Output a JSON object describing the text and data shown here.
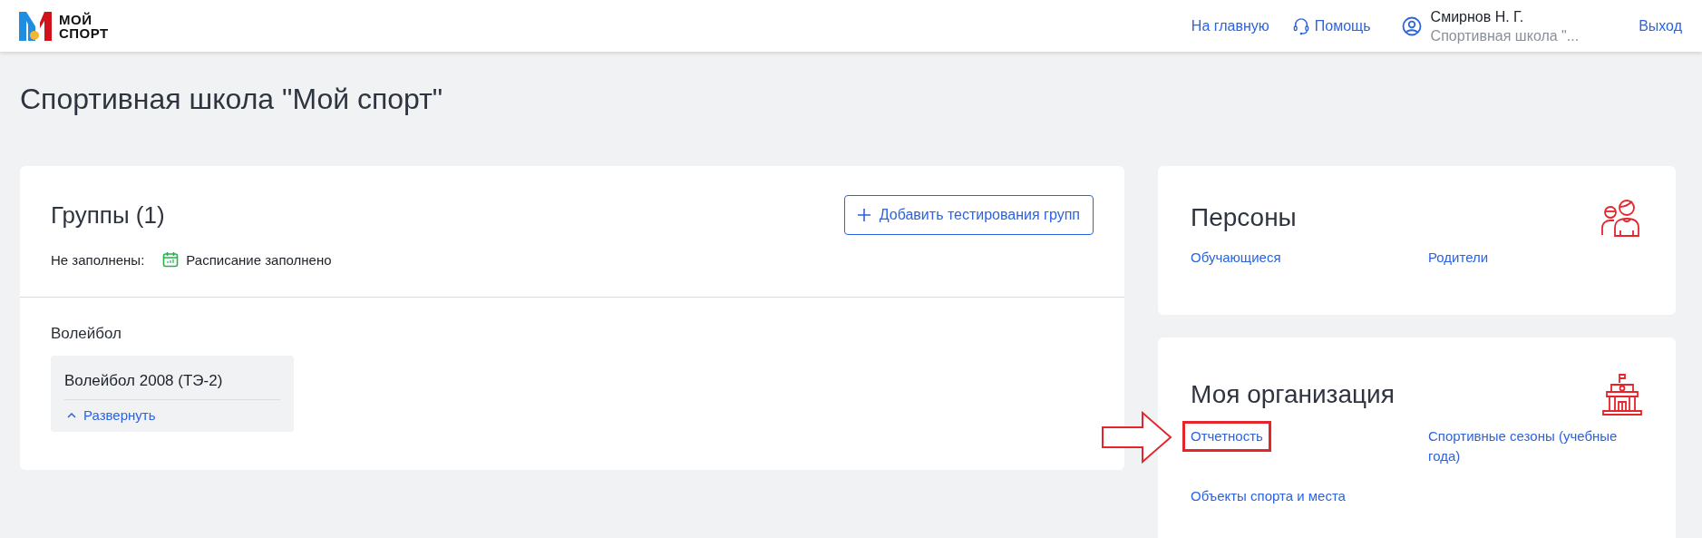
{
  "header": {
    "logo": [
      "МОЙ",
      "СПОРТ"
    ],
    "links": [
      {
        "label": "На главную",
        "kind": "plain"
      },
      {
        "label": "Помощь",
        "kind": "help"
      }
    ],
    "user": {
      "name": "Смирнов Н. Г.",
      "org": "Спортивная школа \"..."
    },
    "logout": "Выход"
  },
  "page_title": "Спортивная школа \"Мой спорт\"",
  "groups": {
    "title": "Группы (1)",
    "add_button": "Добавить тестирования групп",
    "not_filled_label": "Не заполнены:",
    "schedule_status": "Расписание заполнено",
    "sports": [
      {
        "name": "Волейбол",
        "groups": [
          {
            "name": "Волейбол 2008 (ТЭ-2)",
            "expand_label": "Развернуть",
            "expanded": true
          }
        ]
      }
    ]
  },
  "cards": [
    {
      "title": "Персоны",
      "kind": "people",
      "links": [
        {
          "label": "Обучающиеся",
          "highlighted": false
        },
        {
          "label": "Родители",
          "highlighted": false
        }
      ]
    },
    {
      "title": "Моя организация",
      "kind": "building",
      "links": [
        {
          "label": "Отчетность",
          "highlighted": true
        },
        {
          "label": "Спортивные сезоны (учебные года)",
          "highlighted": false
        },
        {
          "label": "Объекты спорта и места",
          "highlighted": false
        }
      ]
    }
  ]
}
